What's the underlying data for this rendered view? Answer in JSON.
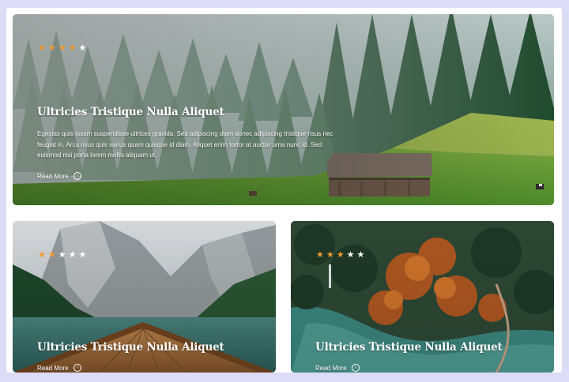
{
  "colors": {
    "page_background": "#dcdcf6",
    "star_filled": "#f29a2e",
    "star_empty": "#ffffff",
    "text": "#ffffff"
  },
  "cards": [
    {
      "stars": {
        "filled": 4,
        "total": 5
      },
      "title": "Ultricies Tristique Nulla Aliquet",
      "description": "Egestas quis ipsum suspendisse ultrices gravida. Sed adipiscing diam donec adipiscing tristique risus nec feugiat in. Arcu risus quis varius quam quisque id diam. Aliquet enim tortor at auctor urna nunc id. Sed euismod nisi porta lorem mollis aliquam ut.",
      "read_more": "Read More",
      "read_more_icon": "arrow-circle-right-icon",
      "image": "misty forest with wooden cabin on green meadow"
    },
    {
      "stars": {
        "filled": 2,
        "total": 5
      },
      "title": "Ultricies Tristique Nulla Aliquet",
      "read_more": "Read More",
      "read_more_icon": "arrow-circle-right-icon",
      "image": "mountain lake with wooden boat bow"
    },
    {
      "stars": {
        "filled": 3,
        "total": 5
      },
      "title": "Ultricies Tristique Nulla Aliquet",
      "read_more": "Read More",
      "read_more_icon": "arrow-circle-right-icon",
      "image": "aerial view of autumn forest and river"
    }
  ]
}
